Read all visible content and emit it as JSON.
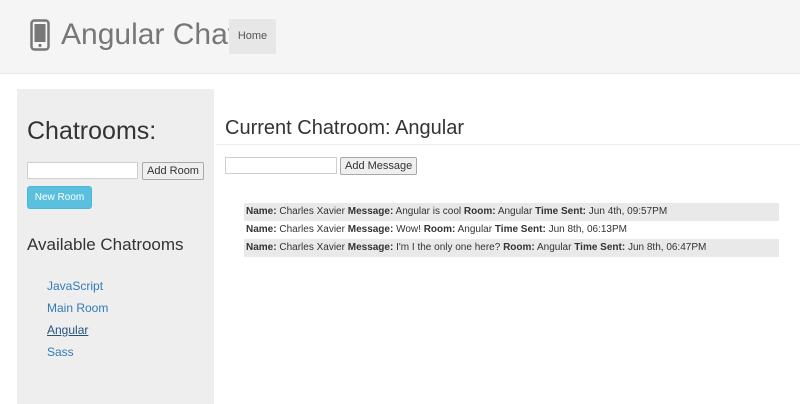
{
  "navbar": {
    "brand": "Angular Chat",
    "brand_icon": "phone-icon",
    "home_label": "Home"
  },
  "sidebar": {
    "title": "Chatrooms:",
    "room_input_value": "",
    "add_room_label": "Add Room",
    "new_room_label": "New Room",
    "available_title": "Available Chatrooms",
    "rooms": [
      {
        "label": "JavaScript",
        "active": false
      },
      {
        "label": "Main Room",
        "active": false
      },
      {
        "label": "Angular",
        "active": true
      },
      {
        "label": "Sass",
        "active": false
      }
    ]
  },
  "main": {
    "title": "Current Chatroom: Angular",
    "message_input_value": "",
    "add_message_label": "Add Message",
    "field_labels": {
      "name": "Name:",
      "message": "Message:",
      "room": "Room:",
      "time": "Time Sent:"
    },
    "messages": [
      {
        "name": "Charles Xavier",
        "message": "Angular is cool",
        "room": "Angular",
        "time": "Jun 4th, 09:57PM"
      },
      {
        "name": "Charles Xavier",
        "message": "Wow!",
        "room": "Angular",
        "time": "Jun 8th, 06:13PM"
      },
      {
        "name": "Charles Xavier",
        "message": "I'm I the only one here?",
        "room": "Angular",
        "time": "Jun 8th, 06:47PM"
      }
    ]
  },
  "colors": {
    "navbar_bg": "#f5f5f5",
    "sidebar_bg": "#eeeeee",
    "link": "#337ab7",
    "info_button": "#5bc0de",
    "stripe": "#e9e9e9"
  }
}
